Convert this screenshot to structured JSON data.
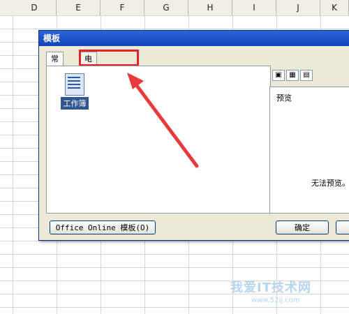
{
  "columns": [
    "D",
    "E",
    "F",
    "G",
    "H",
    "I",
    "J",
    "K"
  ],
  "dialog": {
    "title": "模板",
    "tabs": [
      {
        "label": "常用",
        "active": true
      },
      {
        "label": "电子方案表格",
        "active": false
      }
    ],
    "file_item": {
      "label": "工作簿",
      "icon": "workbook-icon"
    },
    "preview_label": "预览",
    "preview_message": "无法预览。",
    "buttons": {
      "online": "Office Online 模板(O)",
      "ok": "确定"
    }
  },
  "watermark": {
    "text": "我爱IT技术网",
    "url": "www.52ij.com"
  },
  "colors": {
    "title_bar": "#1552c8",
    "highlight": "#e0262a",
    "arrow": "#e83a3a"
  }
}
